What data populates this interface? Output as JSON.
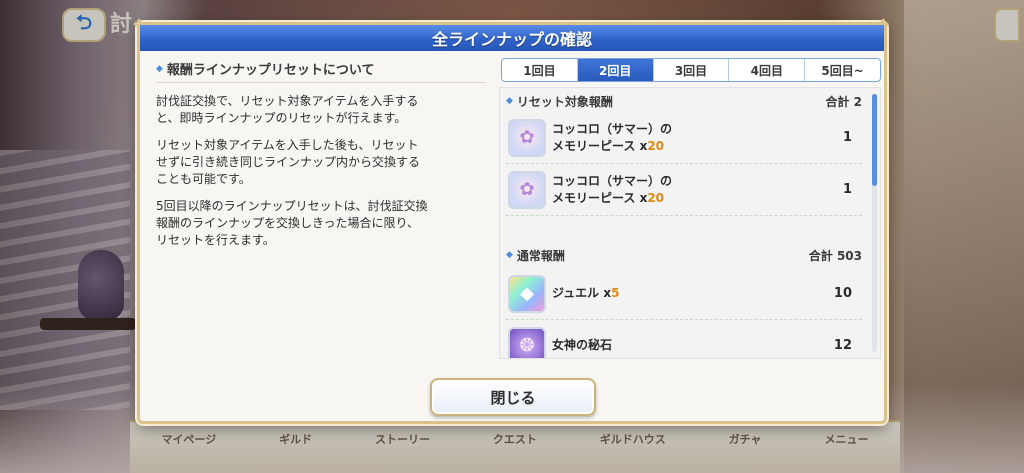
{
  "background": {
    "back_button_glyph": "⮌",
    "title_partial": "討",
    "nav_items": [
      "マイページ",
      "ギルド",
      "ストーリー",
      "クエスト",
      "ギルドハウス",
      "ガチャ",
      "メニュー"
    ]
  },
  "modal": {
    "title": "全ラインナップの確認",
    "close_label": "閉じる"
  },
  "info": {
    "heading": "報酬ラインナップリセットについて",
    "paragraphs": [
      "討伐証交換で、リセット対象アイテムを入手する\nと、即時ラインナップのリセットが行えます。",
      "リセット対象アイテムを入手した後も、リセット\nせずに引き続き同じラインナップ内から交換する\nことも可能です。",
      "5回目以降のラインナップリセットは、討伐証交換\n報酬のラインナップを交換しきった場合に限り、\nリセットを行えます。"
    ]
  },
  "tabs": [
    "1回目",
    "2回目",
    "3回目",
    "4回目",
    "5回目~"
  ],
  "active_tab": 1,
  "groups": [
    {
      "label": "リセット対象報酬",
      "total_label": "合計 2",
      "items": [
        {
          "name_line1": "コッコロ（サマー）の",
          "name_line2": "メモリーピース x",
          "mult": "20",
          "count": "1",
          "icon": "memory-piece-icon"
        },
        {
          "name_line1": "コッコロ（サマー）の",
          "name_line2": "メモリーピース x",
          "mult": "20",
          "count": "1",
          "icon": "memory-piece-icon"
        }
      ]
    },
    {
      "label": "通常報酬",
      "total_label": "合計 503",
      "items": [
        {
          "name_line1": "ジュエル x",
          "mult": "5",
          "count": "10",
          "icon": "jewel-icon"
        },
        {
          "name_line1": "女神の秘石",
          "mult": "",
          "count": "12",
          "icon": "goddess-stone-icon"
        }
      ]
    }
  ],
  "colors": {
    "header_blue": "#2f63c9",
    "accent_orange": "#e08a12",
    "frame_gold": "#d9c38a"
  }
}
